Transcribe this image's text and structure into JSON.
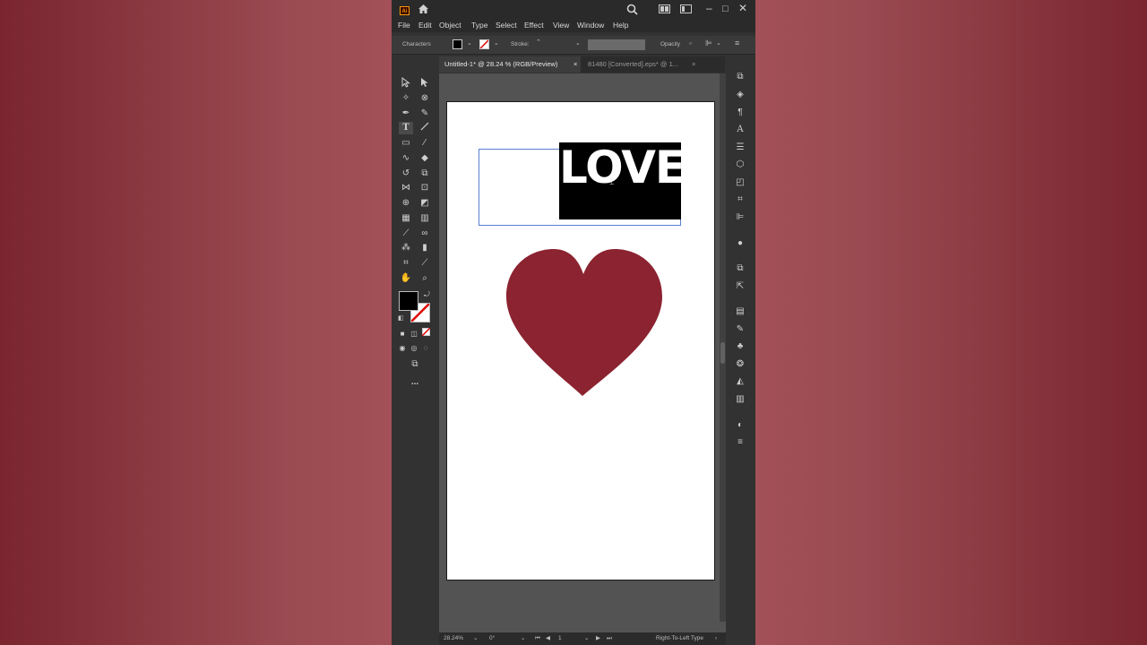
{
  "app": {
    "logo": "Ai"
  },
  "titlebar": {
    "icons": [
      "home-icon",
      "search-icon",
      "arrange-documents-icon",
      "workspace-icon",
      "minimize-icon",
      "maximize-icon",
      "close-icon"
    ]
  },
  "menu": [
    "File",
    "Edit",
    "Object",
    "Type",
    "Select",
    "Effect",
    "View",
    "Window",
    "Help"
  ],
  "control_bar": {
    "panel_label": "Characters",
    "stroke_label": "Stroke:",
    "opacity_label": "Opacity"
  },
  "tabs": [
    {
      "label": "Untitled-1* @ 28.24 % (RGB/Preview)",
      "close": "×",
      "active": true
    },
    {
      "label": "81480 [Converted].eps* @ 1...",
      "close": "×",
      "active": false
    }
  ],
  "canvas": {
    "text": "LOVE",
    "heart_color": "#8b2330",
    "text_box_color": "#000000"
  },
  "status_bar": {
    "zoom": "28.24%",
    "rotation": "0°",
    "artboard": "1",
    "mode": "Right-To-Left Type"
  },
  "colors": {
    "fill": "#000000",
    "stroke": "none"
  },
  "more_tools": "..."
}
